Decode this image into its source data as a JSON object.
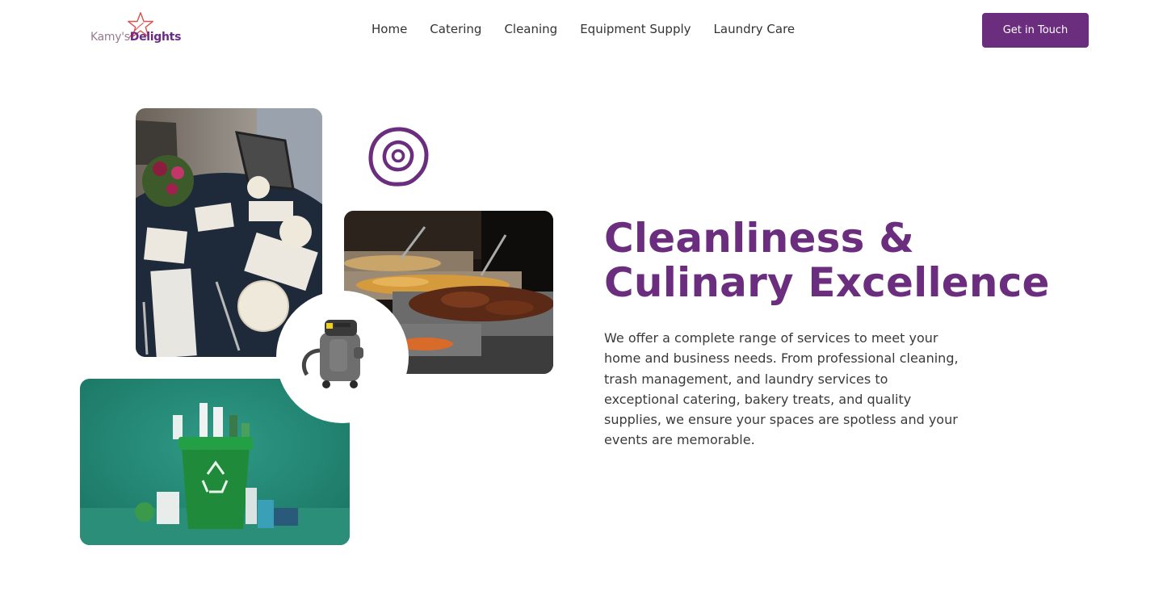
{
  "brand": {
    "name_part1": "Kamy's",
    "name_part2": "Delights",
    "accent_color": "#6b2d7e"
  },
  "nav": {
    "items": [
      "Home",
      "Catering",
      "Cleaning",
      "Equipment Supply",
      "Laundry Care"
    ]
  },
  "header": {
    "cta_label": "Get in Touch"
  },
  "hero": {
    "title_line1": "Cleanliness &",
    "title_line2": "Culinary Excellence",
    "description": "We offer a complete range of services to meet your home and business needs. From professional cleaning, trash management, and laundry services to exceptional catering, bakery treats, and quality supplies, we ensure your spaces are spotless and your events are memorable."
  },
  "icons": [
    "star-logo-icon",
    "swirl-decoration-icon"
  ],
  "images": [
    "dining-table-photo",
    "buffet-photo",
    "vacuum-cleaner-image",
    "recycling-bin-photo"
  ]
}
